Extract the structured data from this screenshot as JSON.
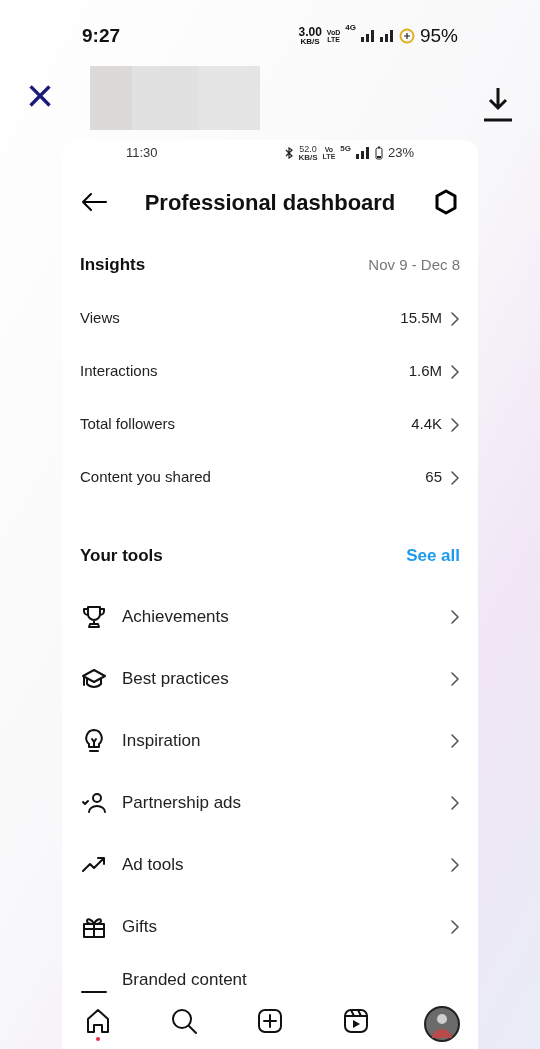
{
  "status_bar": {
    "time": "9:27",
    "speed": "3.00",
    "speed_unit": "KB/S",
    "volte_top": "VoD",
    "volte_bottom": "LTE",
    "network": "4G",
    "battery": "95%"
  },
  "viewer": {
    "close": "×"
  },
  "screenshot": {
    "status_bar": {
      "time": "11:30",
      "speed": "52.0",
      "speed_unit": "KB/S",
      "volte_top": "Vo",
      "volte_bottom": "LTE",
      "network": "5G",
      "battery": "23%"
    },
    "title": "Professional dashboard",
    "insights": {
      "heading": "Insights",
      "date_range": "Nov 9 - Dec 8",
      "rows": [
        {
          "label": "Views",
          "value": "15.5M"
        },
        {
          "label": "Interactions",
          "value": "1.6M"
        },
        {
          "label": "Total followers",
          "value": "4.4K"
        },
        {
          "label": "Content you shared",
          "value": "65"
        }
      ]
    },
    "tools": {
      "heading": "Your tools",
      "link": "See all",
      "items": [
        {
          "label": "Achievements"
        },
        {
          "label": "Best practices"
        },
        {
          "label": "Inspiration"
        },
        {
          "label": "Partnership ads"
        },
        {
          "label": "Ad tools"
        },
        {
          "label": "Gifts"
        },
        {
          "label": "Branded content"
        }
      ]
    },
    "nav": [
      {
        "kind": "home",
        "notification": true
      },
      {
        "kind": "search",
        "notification": false
      },
      {
        "kind": "create",
        "notification": false
      },
      {
        "kind": "reels",
        "notification": false
      },
      {
        "kind": "profile",
        "notification": false
      }
    ]
  }
}
